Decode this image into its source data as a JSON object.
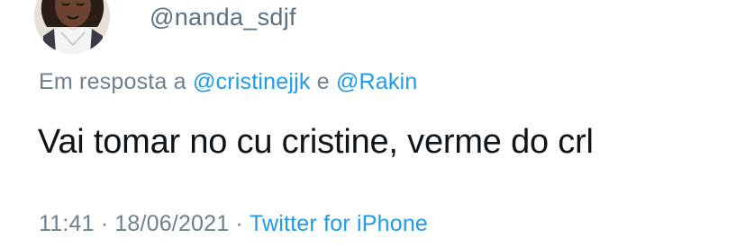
{
  "author": {
    "handle": "@nanda_sdjf",
    "avatar_icon": "profile-avatar"
  },
  "reply_context": {
    "prefix": "Em resposta a",
    "mentions": [
      "@cristinejjk",
      "@Rakin"
    ],
    "conjunction": "e"
  },
  "tweet": {
    "text": "Vai tomar no cu cristine, verme do crl"
  },
  "meta": {
    "time": "11:41",
    "separator": "·",
    "date": "18/06/2021",
    "source": "Twitter for iPhone"
  },
  "colors": {
    "text": "#0f1419",
    "secondary": "#6e7f8f",
    "link": "#1d9bf0",
    "background": "#ffffff"
  }
}
